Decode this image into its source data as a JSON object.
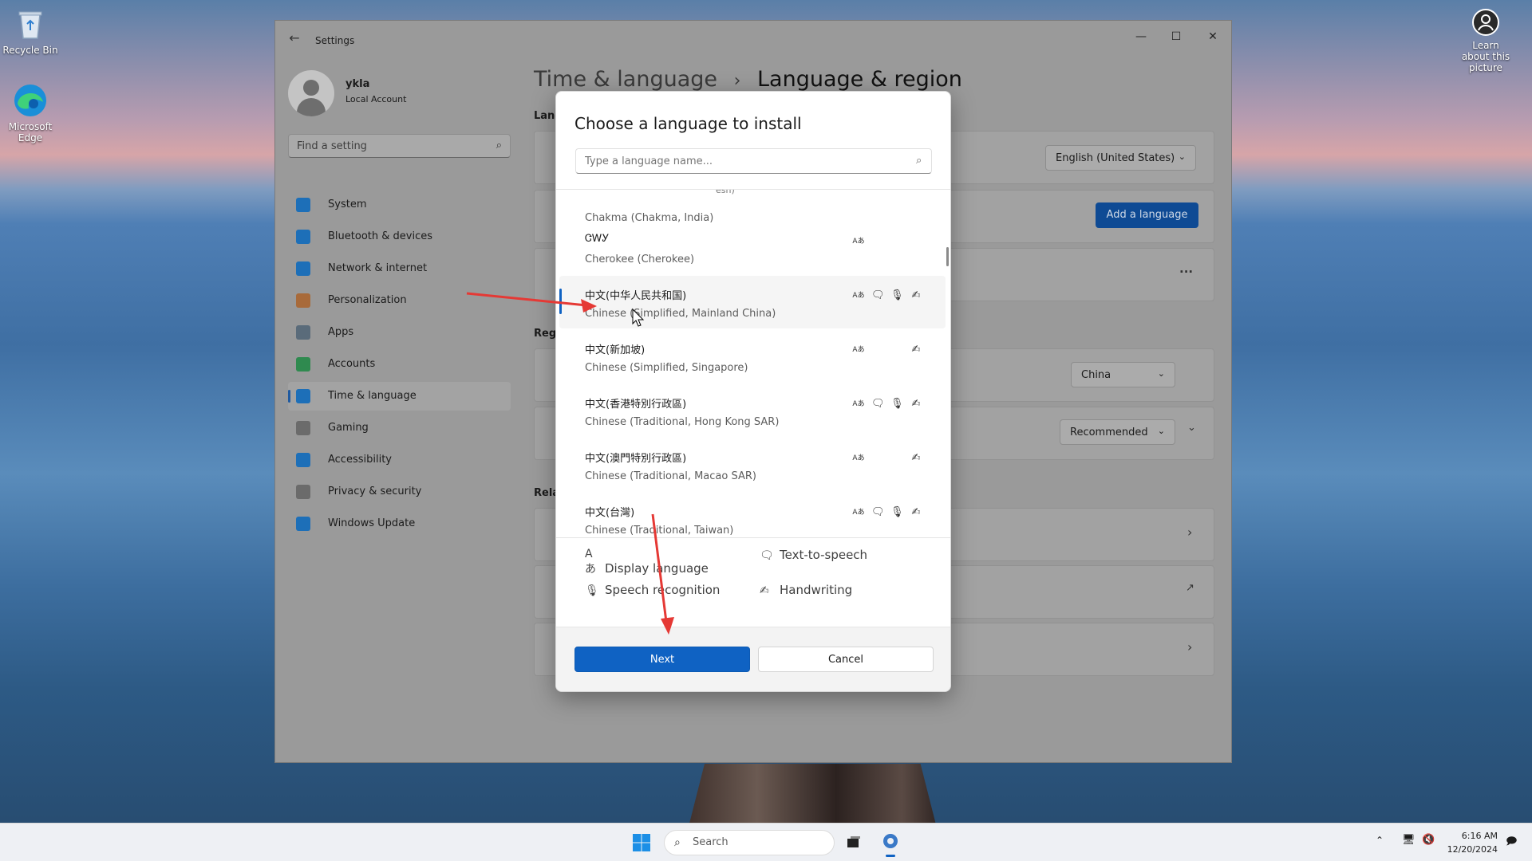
{
  "desktop": {
    "icons": [
      {
        "label": "Recycle Bin"
      },
      {
        "label": "Microsoft Edge"
      },
      {
        "label": "Learn about this picture"
      }
    ]
  },
  "settings_window": {
    "title": "Settings",
    "controls": {
      "minimize": "—",
      "maximize": "☐",
      "close": "✕"
    },
    "profile": {
      "name": "ykla",
      "account_type": "Local Account"
    },
    "search": {
      "placeholder": "Find a setting"
    },
    "nav": [
      {
        "label": "System",
        "icon": "monitor-icon",
        "color": "#1d6fb8"
      },
      {
        "label": "Bluetooth & devices",
        "icon": "bluetooth-icon",
        "color": "#1d6fb8"
      },
      {
        "label": "Network & internet",
        "icon": "wifi-icon",
        "color": "#1d6fb8"
      },
      {
        "label": "Personalization",
        "icon": "brush-icon",
        "color": "#a86a3a"
      },
      {
        "label": "Apps",
        "icon": "apps-icon",
        "color": "#5a6b7a"
      },
      {
        "label": "Accounts",
        "icon": "person-icon",
        "color": "#2f8a4f"
      },
      {
        "label": "Time & language",
        "icon": "globe-clock-icon",
        "color": "#1d6fb8",
        "selected": true
      },
      {
        "label": "Gaming",
        "icon": "gamepad-icon",
        "color": "#6b6b6b"
      },
      {
        "label": "Accessibility",
        "icon": "accessibility-icon",
        "color": "#1d6fb8"
      },
      {
        "label": "Privacy & security",
        "icon": "shield-icon",
        "color": "#6b6b6b"
      },
      {
        "label": "Windows Update",
        "icon": "update-icon",
        "color": "#1d6fb8"
      }
    ],
    "breadcrumb": {
      "parent": "Time & language",
      "separator": "›",
      "current": "Language & region"
    },
    "main": {
      "language_section_label": "Lang",
      "windows_display_language": "English (United States)",
      "add_language_button": "Add a language",
      "region_section_label": "Reg",
      "country": "China",
      "regional_format": "Recommended",
      "related_section_label": "Rela",
      "more_label": "..."
    }
  },
  "dialog": {
    "title": "Choose a language to install",
    "search_placeholder": "Type a language name...",
    "clipped_top_text": "esh)",
    "languages": [
      {
        "native": "",
        "english": "Chakma (Chakma, India)",
        "caps": []
      },
      {
        "native": "ᏣᎳᎩ",
        "english": "Cherokee (Cherokee)",
        "caps": [
          "dl"
        ]
      },
      {
        "native": "中文(中华人民共和国)",
        "english": "Chinese (Simplified, Mainland China)",
        "caps": [
          "dl",
          "tts",
          "sr",
          "hw"
        ],
        "hovered": true
      },
      {
        "native": "中文(新加坡)",
        "english": "Chinese (Simplified, Singapore)",
        "caps": [
          "dl",
          "hw"
        ]
      },
      {
        "native": "中文(香港特別行政區)",
        "english": "Chinese (Traditional, Hong Kong SAR)",
        "caps": [
          "dl",
          "tts",
          "sr",
          "hw"
        ]
      },
      {
        "native": "中文(澳門特別行政區)",
        "english": "Chinese (Traditional, Macao SAR)",
        "caps": [
          "dl",
          "hw"
        ]
      },
      {
        "native": "中文(台灣)",
        "english": "Chinese (Traditional, Taiwan)",
        "caps": [
          "dl",
          "tts",
          "sr",
          "hw"
        ]
      }
    ],
    "legend": {
      "display_language": "Display language",
      "text_to_speech": "Text-to-speech",
      "speech_recognition": "Speech recognition",
      "handwriting": "Handwriting"
    },
    "next_button": "Next",
    "cancel_button": "Cancel"
  },
  "taskbar": {
    "search_placeholder": "Search",
    "time": "6:16 AM",
    "date": "12/20/2024"
  },
  "annotation_color": "#e53935"
}
